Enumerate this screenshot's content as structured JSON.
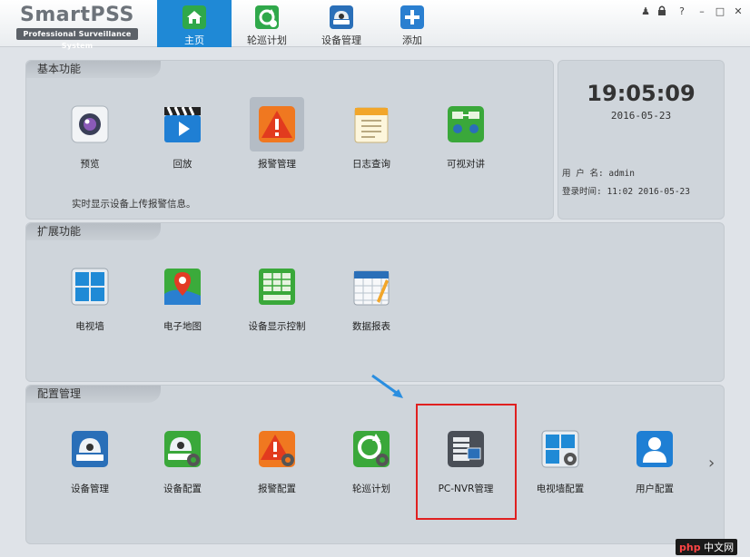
{
  "app": {
    "name": "SmartPSS",
    "subtitle": "Professional Surveillance System"
  },
  "nav": [
    {
      "label": "主页",
      "icon": "home-icon",
      "active": true
    },
    {
      "label": "轮巡计划",
      "icon": "tour-refresh-icon"
    },
    {
      "label": "设备管理",
      "icon": "camera-device-icon"
    },
    {
      "label": "添加",
      "icon": "plus-icon"
    }
  ],
  "window_controls": {
    "user": "♟",
    "lock": "🔒",
    "help": "?",
    "minimize": "–",
    "maximize": "□",
    "close": "✕"
  },
  "basic": {
    "title": "基本功能",
    "description": "实时显示设备上传报警信息。",
    "items": [
      {
        "label": "预览",
        "icon": "preview-lens-icon"
      },
      {
        "label": "回放",
        "icon": "playback-clapper-icon"
      },
      {
        "label": "报警管理",
        "icon": "alarm-warning-icon"
      },
      {
        "label": "日志查询",
        "icon": "log-notepad-icon"
      },
      {
        "label": "可视对讲",
        "icon": "intercom-icon"
      }
    ]
  },
  "clock": {
    "time": "19:05:09",
    "date": "2016-05-23",
    "user_label": "用 户 名:",
    "user_value": "admin",
    "login_label": "登录时间:",
    "login_value": "11:02 2016-05-23"
  },
  "extended": {
    "title": "扩展功能",
    "items": [
      {
        "label": "电视墙",
        "icon": "tv-wall-icon"
      },
      {
        "label": "电子地图",
        "icon": "emap-pin-icon"
      },
      {
        "label": "设备显示控制",
        "icon": "display-control-icon"
      },
      {
        "label": "数据报表",
        "icon": "data-report-icon"
      }
    ]
  },
  "config": {
    "title": "配置管理",
    "items": [
      {
        "label": "设备管理",
        "icon": "device-manage-icon"
      },
      {
        "label": "设备配置",
        "icon": "device-config-icon"
      },
      {
        "label": "报警配置",
        "icon": "alarm-config-icon"
      },
      {
        "label": "轮巡计划",
        "icon": "tour-plan-icon"
      },
      {
        "label": "PC-NVR管理",
        "icon": "pc-nvr-icon"
      },
      {
        "label": "电视墙配置",
        "icon": "tv-wall-config-icon"
      },
      {
        "label": "用户配置",
        "icon": "user-config-icon"
      }
    ],
    "next": "›"
  },
  "watermark": {
    "php": "php",
    "site": "中文网"
  }
}
